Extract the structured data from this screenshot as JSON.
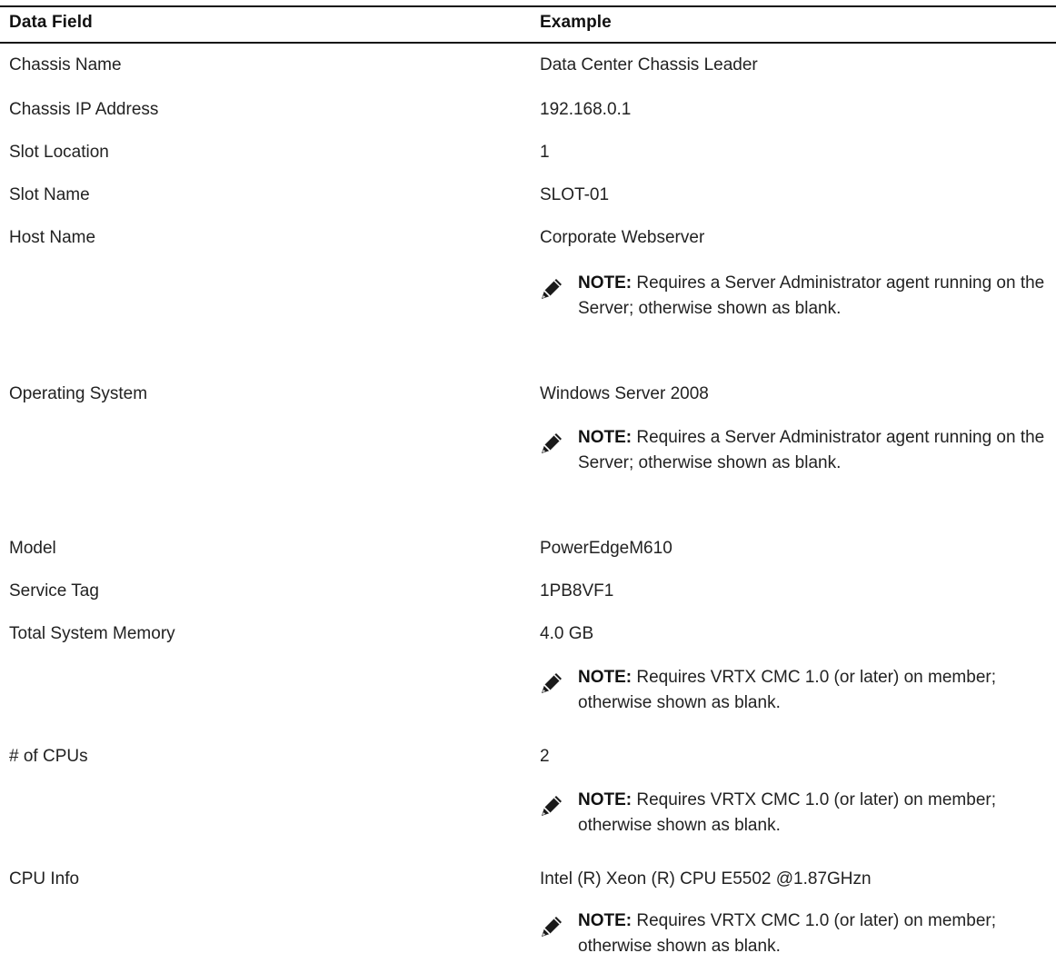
{
  "table": {
    "headers": [
      "Data Field",
      "Example"
    ],
    "rows": [
      {
        "field": "Chassis Name",
        "value": "Data Center Chassis Leader"
      },
      {
        "field": "Chassis IP Address",
        "value": "192.168.0.1"
      },
      {
        "field": "Slot Location",
        "value": "1"
      },
      {
        "field": "Slot Name",
        "value": "SLOT-01"
      },
      {
        "field": "Host Name",
        "value": "Corporate Webserver",
        "note": {
          "label": "NOTE:",
          "text": " Requires a Server Administrator agent running on the Server; otherwise shown as blank."
        }
      },
      {
        "field": "Operating System",
        "value": "Windows Server 2008",
        "note": {
          "label": "NOTE:",
          "text": " Requires a Server Administrator agent running on the Server; otherwise shown as blank."
        }
      },
      {
        "field": "Model",
        "value": "PowerEdgeM610"
      },
      {
        "field": "Service Tag",
        "value": "1PB8VF1"
      },
      {
        "field": "Total System Memory",
        "value": "4.0 GB",
        "note": {
          "label": "NOTE:",
          "text": " Requires VRTX CMC 1.0 (or later) on member; otherwise shown as blank."
        }
      },
      {
        "field": "# of CPUs",
        "value": "2",
        "note": {
          "label": "NOTE:",
          "text": " Requires VRTX CMC 1.0 (or later) on member; otherwise shown as blank."
        }
      },
      {
        "field": "CPU Info",
        "value": "Intel (R) Xeon (R) CPU E5502 @1.87GHzn",
        "note": {
          "label": "NOTE:",
          "text": " Requires VRTX CMC 1.0 (or later) on member; otherwise shown as blank."
        }
      }
    ]
  },
  "icons": {
    "note": "pencil-note-icon"
  }
}
